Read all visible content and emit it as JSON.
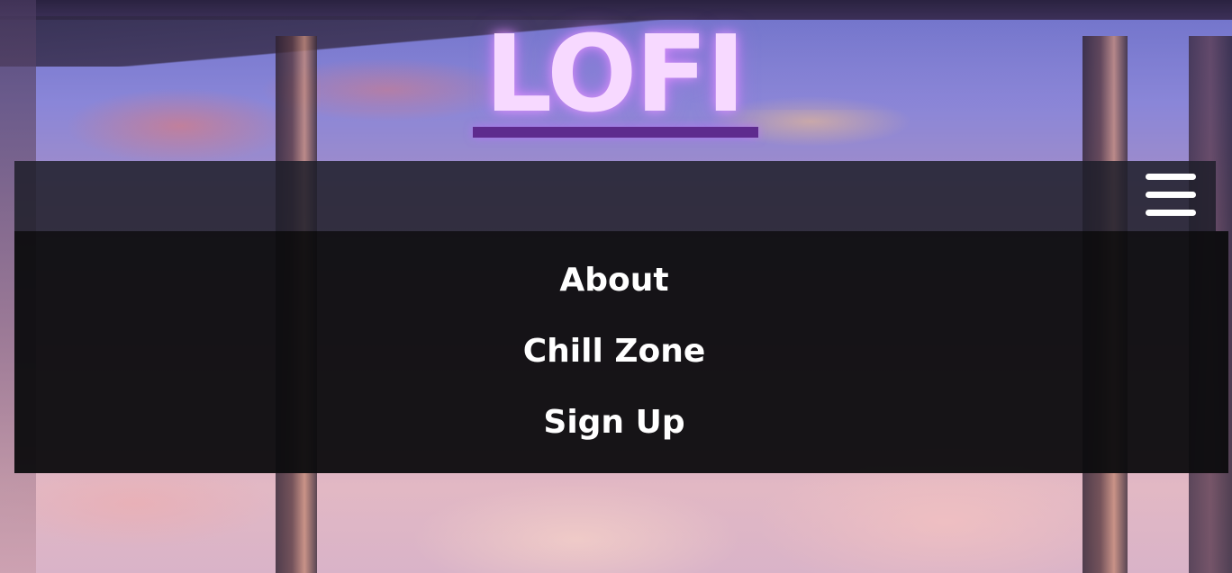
{
  "logo": {
    "text": "LOFI"
  },
  "navbar": {
    "menu_icon": "hamburger-menu-icon"
  },
  "menu": {
    "items": [
      {
        "label": "About"
      },
      {
        "label": "Chill Zone"
      },
      {
        "label": "Sign Up"
      }
    ]
  },
  "colors": {
    "logo_text": "#f7d9ff",
    "logo_underline": "#5e2b8e",
    "navbar_bg": "#1e1e2a",
    "menu_bg": "#0c0c0e",
    "menu_text": "#ffffff"
  }
}
